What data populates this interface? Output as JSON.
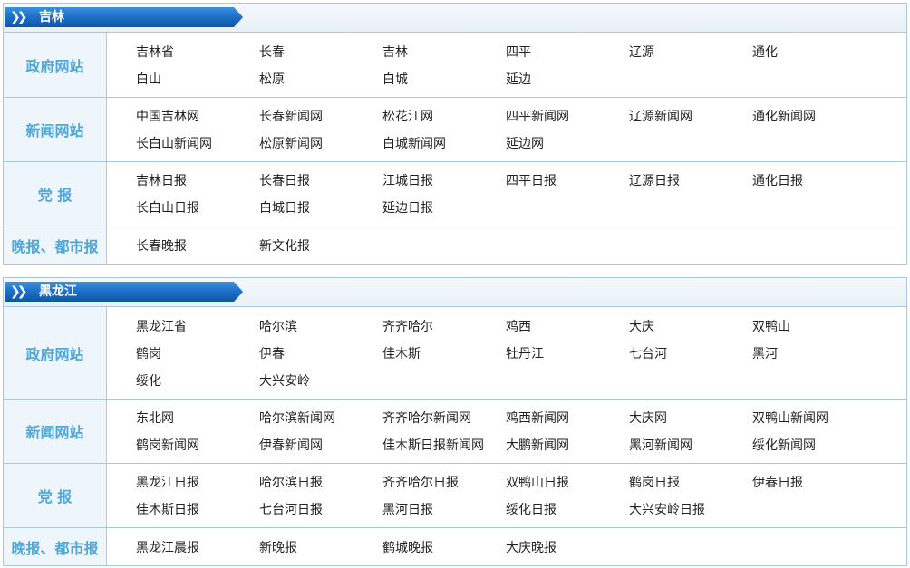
{
  "sections": [
    {
      "title": "吉林",
      "rows": [
        {
          "category": "政府网站",
          "links": [
            "吉林省",
            "长春",
            "吉林",
            "四平",
            "辽源",
            "通化",
            "白山",
            "松原",
            "白城",
            "延边"
          ]
        },
        {
          "category": "新闻网站",
          "links": [
            "中国吉林网",
            "长春新闻网",
            "松花江网",
            "四平新闻网",
            "辽源新闻网",
            "通化新闻网",
            "长白山新闻网",
            "松原新闻网",
            "白城新闻网",
            "延边网"
          ]
        },
        {
          "category": "党 报",
          "links": [
            "吉林日报",
            "长春日报",
            "江城日报",
            "四平日报",
            "辽源日报",
            "通化日报",
            "长白山日报",
            "白城日报",
            "延边日报"
          ]
        },
        {
          "category": "晚报、都市报",
          "links": [
            "长春晚报",
            "新文化报"
          ]
        }
      ]
    },
    {
      "title": "黑龙江",
      "rows": [
        {
          "category": "政府网站",
          "links": [
            "黑龙江省",
            "哈尔滨",
            "齐齐哈尔",
            "鸡西",
            "大庆",
            "双鸭山",
            "鹤岗",
            "伊春",
            "佳木斯",
            "牡丹江",
            "七台河",
            "黑河",
            "绥化",
            "大兴安岭"
          ]
        },
        {
          "category": "新闻网站",
          "links": [
            "东北网",
            "哈尔滨新闻网",
            "齐齐哈尔新闻网",
            "鸡西新闻网",
            "大庆网",
            "双鸭山新闻网",
            "鹤岗新闻网",
            "伊春新闻网",
            "佳木斯日报新闻网",
            "大鹏新闻网",
            "黑河新闻网",
            "绥化新闻网"
          ]
        },
        {
          "category": "党 报",
          "links": [
            "黑龙江日报",
            "哈尔滨日报",
            "齐齐哈尔日报",
            "双鸭山日报",
            "鹤岗日报",
            "伊春日报",
            "佳木斯日报",
            "七台河日报",
            "黑河日报",
            "绥化日报",
            "大兴安岭日报"
          ]
        },
        {
          "category": "晚报、都市报",
          "links": [
            "黑龙江晨报",
            "新晚报",
            "鹤城晚报",
            "大庆晚报"
          ]
        }
      ]
    }
  ],
  "colors": {
    "accent": "#1c6fc6",
    "category_text": "#4ea8da",
    "border": "#a9c9e3"
  },
  "icons": {
    "section_tag": "double-chevron-right-icon"
  }
}
